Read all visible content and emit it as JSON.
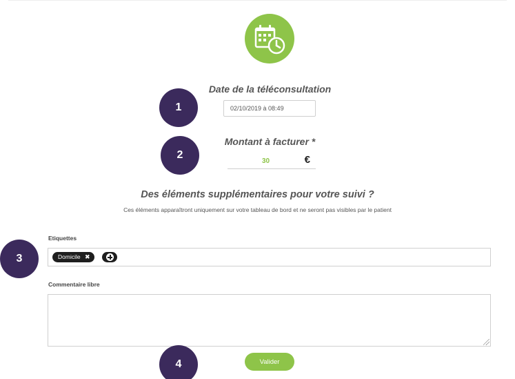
{
  "icons": {
    "logo": "calendar-clock-icon",
    "tag_remove": "close-icon",
    "tag_add": "plus-icon"
  },
  "colors": {
    "accent": "#8ec449",
    "callout": "#3b2a5c",
    "tag": "#1e1e1e"
  },
  "date_section": {
    "title": "Date de la téléconsultation",
    "value": "02/10/2019 à 08:49"
  },
  "amount_section": {
    "title": "Montant à facturer *",
    "value": "30",
    "currency": "€"
  },
  "extra_section": {
    "title": "Des éléments supplémentaires pour votre suivi ?",
    "subtitle": "Ces éléments apparaîtront uniquement sur votre tableau de bord et ne seront pas visibles par le patient"
  },
  "tags_field": {
    "label": "Etiquettes",
    "tags": [
      {
        "label": "Domicile",
        "remove": "✖"
      }
    ]
  },
  "comment_field": {
    "label": "Commentaire libre",
    "value": ""
  },
  "submit": {
    "label": "Valider"
  },
  "callouts": [
    "1",
    "2",
    "3",
    "4"
  ]
}
